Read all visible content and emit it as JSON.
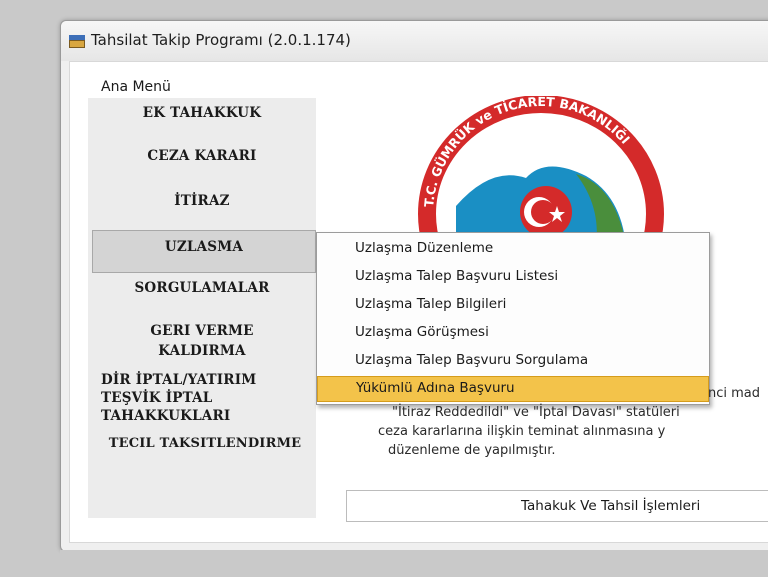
{
  "window": {
    "title": "Tahsilat Takip Programı (2.0.1.174)"
  },
  "menu": {
    "caption": "Ana Menü",
    "items": [
      {
        "label": "EK TAHAKKUK"
      },
      {
        "label": "CEZA KARARI"
      },
      {
        "label": "İTİRAZ"
      },
      {
        "label": "UZLASMA"
      },
      {
        "label": "SORGULAMALAR"
      },
      {
        "label": "GERI VERME"
      },
      {
        "label": "KALDIRMA"
      },
      {
        "label": "DİR İPTAL/YATIRIM"
      },
      {
        "label": "TEŞVİK İPTAL"
      },
      {
        "label": "TAHAKKUKLARI"
      },
      {
        "label": "TECIL TAKSITLENDIRME"
      }
    ]
  },
  "logo": {
    "ring_text": "T.C. GÜMRÜK ve TİCARET BAKANLIĞI",
    "red": "#d42a2a",
    "teal": "#1a8fc4",
    "green": "#4a8e3c"
  },
  "dropdown": {
    "items": [
      {
        "label": "Uzlaşma Düzenleme"
      },
      {
        "label": "Uzlaşma Talep Başvuru Listesi"
      },
      {
        "label": "Uzlaşma Talep Bilgileri"
      },
      {
        "label": "Uzlaşma Görüşmesi"
      },
      {
        "label": "Uzlaşma Talep Başvuru Sorgulama"
      },
      {
        "label": "Yükümlü Adına Başvuru"
      }
    ],
    "highlight_color": "#f3c34a"
  },
  "description": {
    "line1": "nci mad",
    "line2": "\"İtiraz Reddedildi\" ve \"İptal Davası\" statüleri",
    "line3": "ceza kararlarına ilişkin teminat alınmasına y",
    "line4": "düzenleme de yapılmıştır."
  },
  "action_button": {
    "label": "Tahakuk Ve Tahsil İşlemleri"
  }
}
